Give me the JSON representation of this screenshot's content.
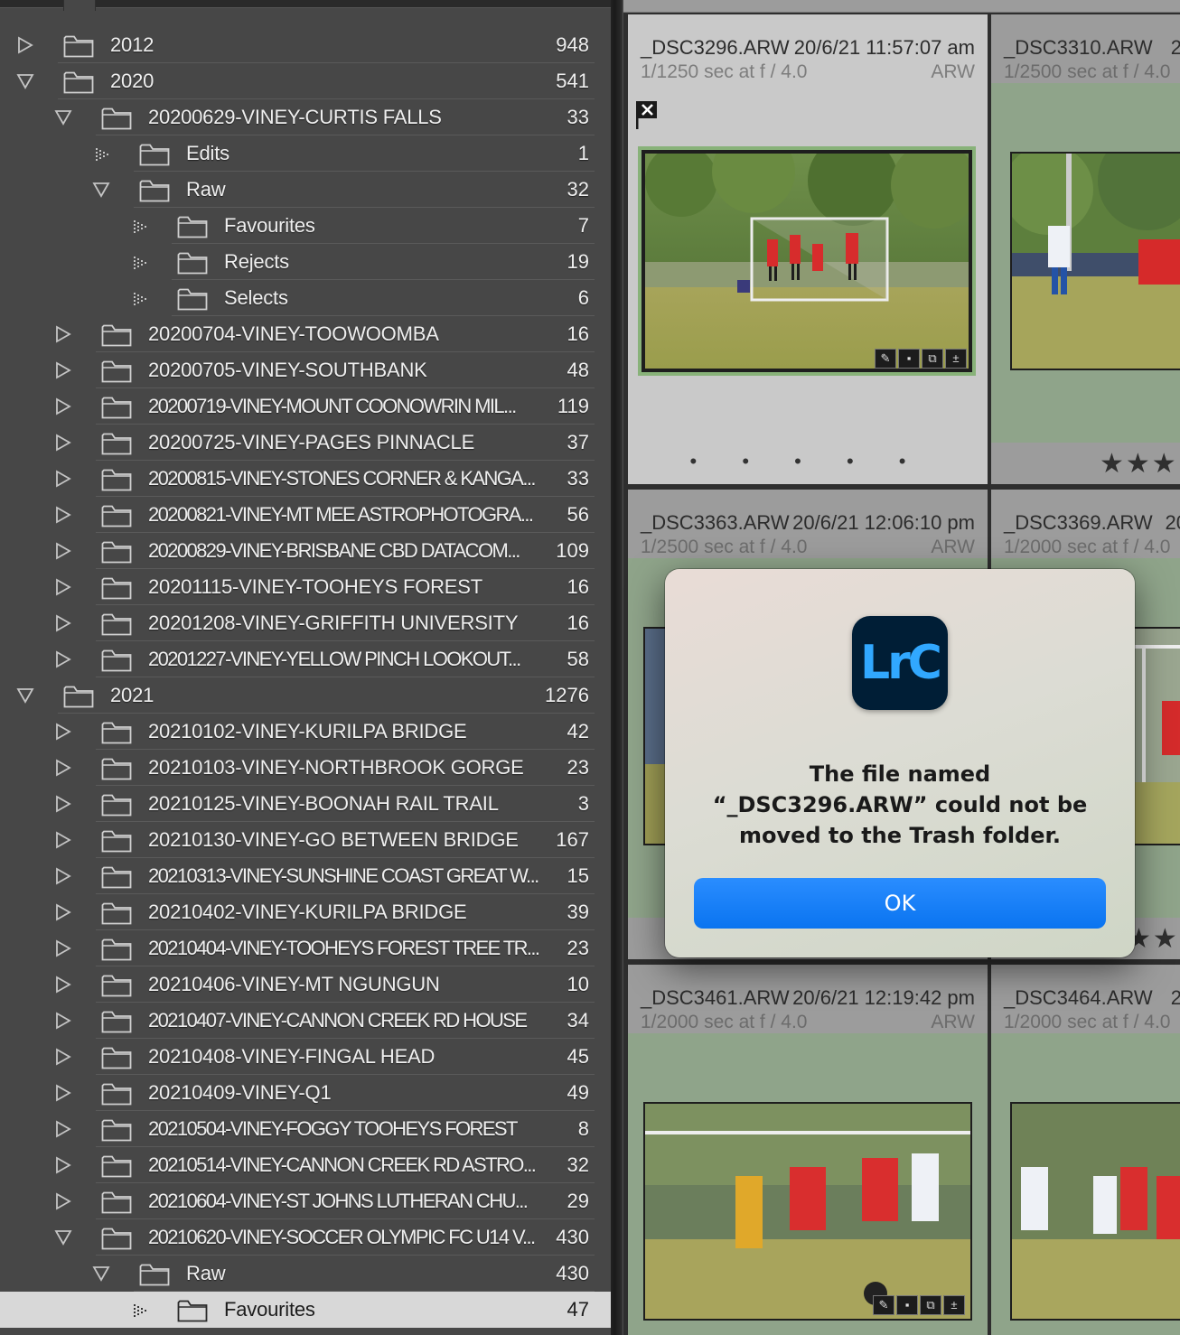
{
  "folders": [
    {
      "level": 0,
      "expanded": false,
      "name": "2012",
      "count": "948"
    },
    {
      "level": 0,
      "expanded": true,
      "name": "2020",
      "count": "541"
    },
    {
      "level": 1,
      "expanded": true,
      "name": "20200629-VINEY-CURTIS FALLS",
      "count": "33"
    },
    {
      "level": 2,
      "leaf": true,
      "name": "Edits",
      "count": "1"
    },
    {
      "level": 2,
      "expanded": true,
      "name": "Raw",
      "count": "32"
    },
    {
      "level": 3,
      "leaf": true,
      "name": "Favourites",
      "count": "7"
    },
    {
      "level": 3,
      "leaf": true,
      "name": "Rejects",
      "count": "19"
    },
    {
      "level": 3,
      "leaf": true,
      "name": "Selects",
      "count": "6"
    },
    {
      "level": 1,
      "expanded": false,
      "name": "20200704-VINEY-TOOWOOMBA",
      "count": "16"
    },
    {
      "level": 1,
      "expanded": false,
      "name": "20200705-VINEY-SOUTHBANK",
      "count": "48"
    },
    {
      "level": 1,
      "expanded": false,
      "name": "20200719-VINEY-MOUNT COONOWRIN MIL...",
      "count": "119",
      "cond": true
    },
    {
      "level": 1,
      "expanded": false,
      "name": "20200725-VINEY-PAGES PINNACLE",
      "count": "37"
    },
    {
      "level": 1,
      "expanded": false,
      "name": "20200815-VINEY-STONES CORNER & KANGA...",
      "count": "33",
      "cond": true
    },
    {
      "level": 1,
      "expanded": false,
      "name": "20200821-VINEY-MT MEE ASTROPHOTOGRA...",
      "count": "56",
      "cond": true
    },
    {
      "level": 1,
      "expanded": false,
      "name": "20200829-VINEY-BRISBANE CBD DATACOM...",
      "count": "109",
      "cond": true
    },
    {
      "level": 1,
      "expanded": false,
      "name": "20201115-VINEY-TOOHEYS FOREST",
      "count": "16"
    },
    {
      "level": 1,
      "expanded": false,
      "name": "20201208-VINEY-GRIFFITH UNIVERSITY",
      "count": "16"
    },
    {
      "level": 1,
      "expanded": false,
      "name": "20201227-VINEY-YELLOW PINCH LOOKOUT...",
      "count": "58",
      "cond": true
    },
    {
      "level": 0,
      "expanded": true,
      "name": "2021",
      "count": "1276"
    },
    {
      "level": 1,
      "expanded": false,
      "name": "20210102-VINEY-KURILPA BRIDGE",
      "count": "42"
    },
    {
      "level": 1,
      "expanded": false,
      "name": "20210103-VINEY-NORTHBROOK GORGE",
      "count": "23"
    },
    {
      "level": 1,
      "expanded": false,
      "name": "20210125-VINEY-BOONAH RAIL TRAIL",
      "count": "3"
    },
    {
      "level": 1,
      "expanded": false,
      "name": "20210130-VINEY-GO BETWEEN BRIDGE",
      "count": "167"
    },
    {
      "level": 1,
      "expanded": false,
      "name": "20210313-VINEY-SUNSHINE COAST GREAT W...",
      "count": "15",
      "cond": true
    },
    {
      "level": 1,
      "expanded": false,
      "name": "20210402-VINEY-KURILPA BRIDGE",
      "count": "39"
    },
    {
      "level": 1,
      "expanded": false,
      "name": "20210404-VINEY-TOOHEYS FOREST TREE TR...",
      "count": "23",
      "cond": true
    },
    {
      "level": 1,
      "expanded": false,
      "name": "20210406-VINEY-MT NGUNGUN",
      "count": "10"
    },
    {
      "level": 1,
      "expanded": false,
      "name": "20210407-VINEY-CANNON CREEK RD HOUSE",
      "count": "34",
      "cond": true
    },
    {
      "level": 1,
      "expanded": false,
      "name": "20210408-VINEY-FINGAL HEAD",
      "count": "45"
    },
    {
      "level": 1,
      "expanded": false,
      "name": "20210409-VINEY-Q1",
      "count": "49"
    },
    {
      "level": 1,
      "expanded": false,
      "name": "20210504-VINEY-FOGGY TOOHEYS FOREST",
      "count": "8",
      "cond": true
    },
    {
      "level": 1,
      "expanded": false,
      "name": "20210514-VINEY-CANNON CREEK RD ASTRO...",
      "count": "32",
      "cond": true
    },
    {
      "level": 1,
      "expanded": false,
      "name": "20210604-VINEY-ST JOHNS LUTHERAN CHU...",
      "count": "29",
      "cond": true
    },
    {
      "level": 1,
      "expanded": true,
      "name": "20210620-VINEY-SOCCER OLYMPIC FC U14 V...",
      "count": "430",
      "cond": true
    },
    {
      "level": 2,
      "expanded": true,
      "name": "Raw",
      "count": "430"
    },
    {
      "level": 3,
      "leaf": true,
      "name": "Favourites",
      "count": "47",
      "selected": true
    }
  ],
  "grid": [
    {
      "filename": "_DSC3296.ARW",
      "date": "20/6/21 11:57:07 am",
      "exposure": "1/1250 sec at f / 4.0",
      "format": "ARW",
      "selected": true,
      "rejected": true
    },
    {
      "filename": "_DSC3310.ARW",
      "date": "2",
      "exposure": "1/2500 sec at f / 4.0",
      "format": "",
      "rating": "★★★"
    },
    {
      "filename": "_DSC3363.ARW",
      "date": "20/6/21 12:06:10 pm",
      "exposure": "1/2500 sec at f / 4.0",
      "format": "ARW"
    },
    {
      "filename": "_DSC3369.ARW",
      "date": "20",
      "exposure": "1/2000 sec at f / 4.0",
      "format": "",
      "rating": "★★"
    },
    {
      "filename": "_DSC3461.ARW",
      "date": "20/6/21 12:19:42 pm",
      "exposure": "1/2000 sec at f / 4.0",
      "format": "ARW"
    },
    {
      "filename": "_DSC3464.ARW",
      "date": "2",
      "exposure": "1/2000 sec at f / 4.0",
      "format": ""
    }
  ],
  "selected_cell_dots": "• • • • •",
  "dialog": {
    "app_icon_text": "LrC",
    "message_line1": "The file named",
    "message_line2": "“_DSC3296.ARW” could not be",
    "message_line3": "moved to the Trash folder.",
    "ok_label": "OK"
  },
  "colors": {
    "panel_bg": "#474747",
    "selected_row_bg": "#d8d8d8",
    "cell_bg": "#8fa48a",
    "selected_cell_bg": "#c9c9c9",
    "ok_button": "#0a74f0",
    "lrc_icon_bg": "#001e36",
    "lrc_icon_text": "#31a8ff"
  }
}
